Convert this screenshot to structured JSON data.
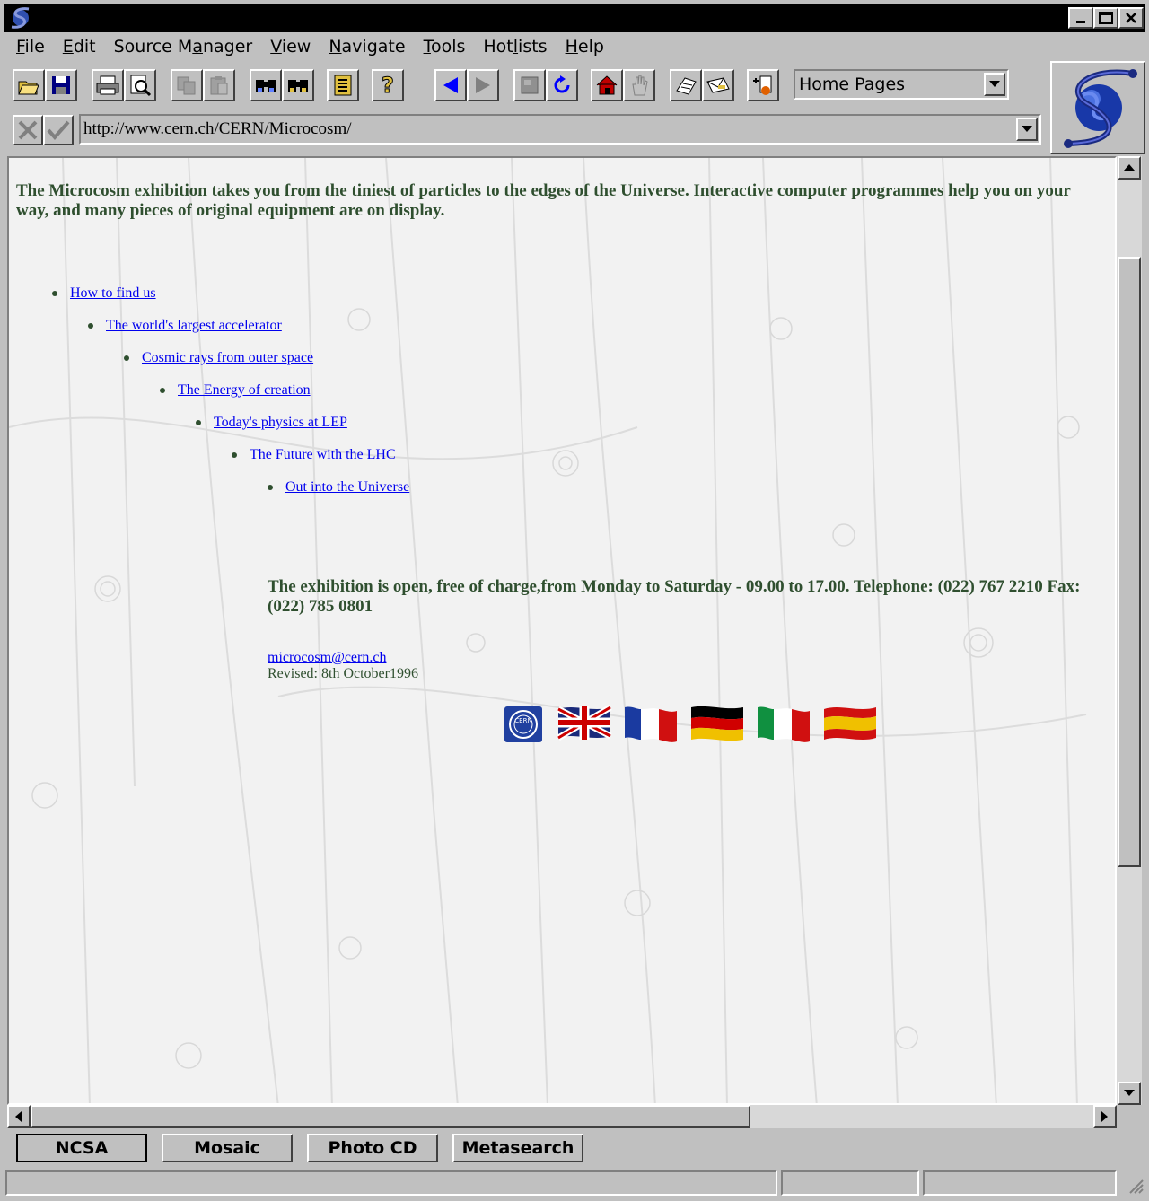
{
  "window": {
    "app_icon": "mosaic-s-icon",
    "controls": [
      "minimize-icon",
      "maximize-icon",
      "close-icon"
    ]
  },
  "menu": [
    {
      "label": "File",
      "u": "F",
      "rest": "ile"
    },
    {
      "label": "Edit",
      "u": "E",
      "rest": "dit"
    },
    {
      "label": "Source Manager",
      "pre": "Source M",
      "u": "a",
      "rest": "nager"
    },
    {
      "label": "View",
      "u": "V",
      "rest": "iew"
    },
    {
      "label": "Navigate",
      "u": "N",
      "rest": "avigate"
    },
    {
      "label": "Tools",
      "u": "T",
      "rest": "ools"
    },
    {
      "label": "Hotlists",
      "pre": "Hot",
      "u": "l",
      "rest": "ists"
    },
    {
      "label": "Help",
      "u": "H",
      "rest": "elp"
    }
  ],
  "toolbar": {
    "hotlist_value": "Home Pages",
    "url": "http://www.cern.ch/CERN/Microcosm/"
  },
  "content": {
    "intro": "The Microcosm exhibition takes you from the tiniest of particles to the edges of the Universe. Interactive computer programmes help you on your way, and many pieces of original equipment are on display.",
    "links": [
      "How to find us",
      "The world's largest accelerator",
      "Cosmic rays from outer space",
      "The Energy of creation",
      "Today's physics at LEP",
      "The Future with the LHC",
      "Out into the Universe"
    ],
    "hours": "The exhibition is open, free of charge,from Monday to Saturday - 09.00 to 17.00. Telephone: (022) 767 2210 Fax: (022) 785 0801",
    "email": "microcosm@cern.ch",
    "revised": "Revised: 8th October1996",
    "flags": [
      "cern-logo-icon",
      "uk-flag-icon",
      "france-flag-icon",
      "germany-flag-icon",
      "italy-flag-icon",
      "spain-flag-icon"
    ]
  },
  "bookmarks": [
    "NCSA",
    "Mosaic",
    "Photo CD",
    "Metasearch"
  ],
  "colors": {
    "link": "#0000ee",
    "text": "#2f4f2f",
    "chrome": "#c0c0c0",
    "titlebar": "#000000"
  }
}
